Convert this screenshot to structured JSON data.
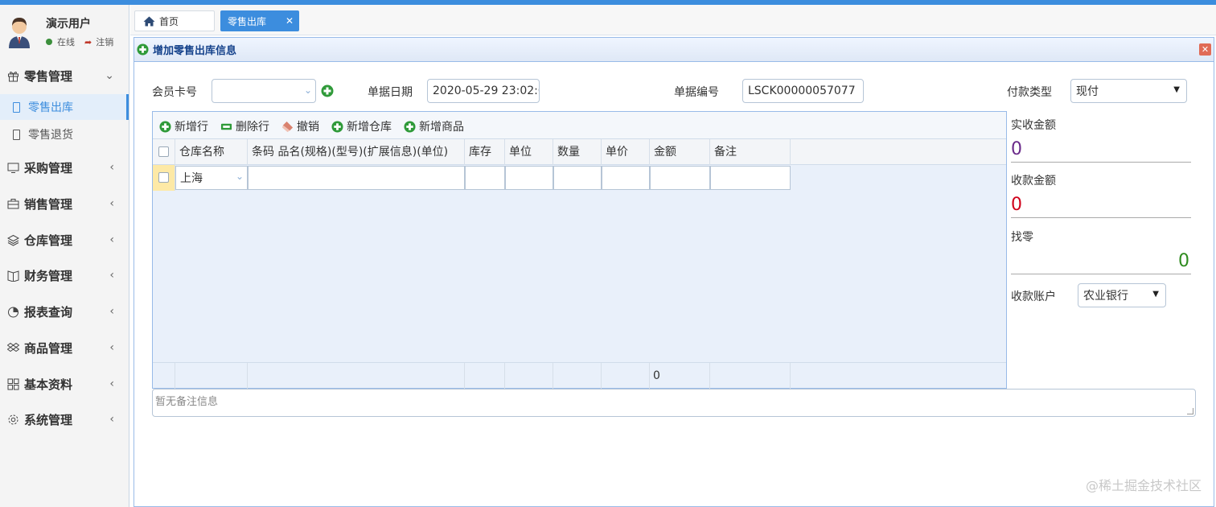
{
  "user": {
    "name": "演示用户",
    "status": "在线",
    "logout": "注销"
  },
  "sidebar": {
    "groups": [
      {
        "label": "零售管理",
        "icon": "gift-icon",
        "expanded": true
      },
      {
        "label": "采购管理",
        "icon": "monitor-icon"
      },
      {
        "label": "销售管理",
        "icon": "briefcase-icon"
      },
      {
        "label": "仓库管理",
        "icon": "layers-icon"
      },
      {
        "label": "财务管理",
        "icon": "book-icon"
      },
      {
        "label": "报表查询",
        "icon": "pie-chart-icon"
      },
      {
        "label": "商品管理",
        "icon": "dropbox-icon"
      },
      {
        "label": "基本资料",
        "icon": "grid-icon"
      },
      {
        "label": "系统管理",
        "icon": "gear-icon"
      }
    ],
    "subitems": [
      {
        "label": "零售出库",
        "active": true
      },
      {
        "label": "零售退货",
        "active": false
      }
    ]
  },
  "tabs": {
    "home": "首页",
    "active": "零售出库"
  },
  "panel": {
    "title": "增加零售出库信息"
  },
  "form": {
    "member_card_label": "会员卡号",
    "member_card_value": "",
    "doc_date_label": "单据日期",
    "doc_date_value": "2020-05-29 23:02:01",
    "doc_no_label": "单据编号",
    "doc_no_value": "LSCK00000057077",
    "pay_type_label": "付款类型",
    "pay_type_value": "现付"
  },
  "toolbar": {
    "add_row": "新增行",
    "delete_row": "删除行",
    "undo": "撤销",
    "add_warehouse": "新增仓库",
    "add_product": "新增商品"
  },
  "grid": {
    "columns": [
      "仓库名称",
      "条码 品名(规格)(型号)(扩展信息)(单位)",
      "库存",
      "单位",
      "数量",
      "单价",
      "金额",
      "备注"
    ],
    "row": {
      "warehouse": "上海"
    },
    "footer_amount": "0"
  },
  "summary": {
    "received_label": "实收金额",
    "received_value": "0",
    "collected_label": "收款金额",
    "collected_value": "0",
    "change_label": "找零",
    "change_value": "0",
    "account_label": "收款账户",
    "account_value": "农业银行"
  },
  "remark": {
    "placeholder": "暂无备注信息"
  },
  "watermark": "@稀土掘金技术社区",
  "colors": {
    "accent": "#3c8dde",
    "received": "#6a2a8a",
    "collected": "#d0021b",
    "change": "#2e8b1e"
  }
}
